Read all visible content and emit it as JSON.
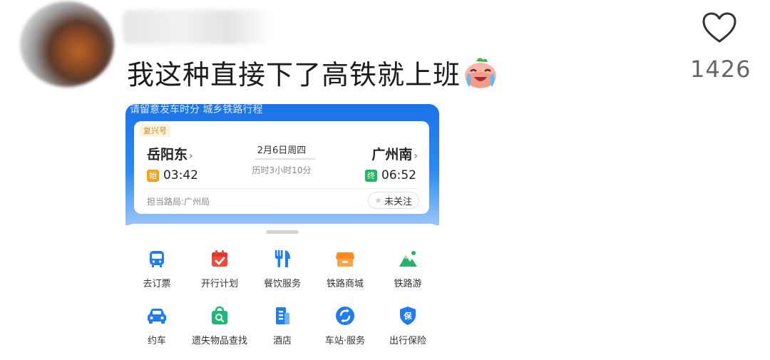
{
  "comment": {
    "text": "我这种直接下了高铁就上班",
    "like_count": "1426"
  },
  "ticket": {
    "cut_text": "请留意发车时分 城乡铁路行程",
    "train_type": "复兴号",
    "from_station": "岳阳东",
    "to_station": "广州南",
    "depart_badge": "始",
    "depart_time": "03:42",
    "arrive_badge": "终",
    "arrive_time": "06:52",
    "date": "2月6日周四",
    "duration": "历时3小时10分",
    "bureau": "担当路局:广州局",
    "follow_label": "未关注",
    "chevron": "›"
  },
  "services": [
    {
      "label": "去订票",
      "icon": "train-ticket-icon",
      "color": "#1f7cf2"
    },
    {
      "label": "开行计划",
      "icon": "calendar-check-icon",
      "color": "#f04b3a"
    },
    {
      "label": "餐饮服务",
      "icon": "fork-knife-icon",
      "color": "#1f7cf2"
    },
    {
      "label": "铁路商城",
      "icon": "shop-icon",
      "color": "#ff8a1f"
    },
    {
      "label": "铁路游",
      "icon": "mountain-icon",
      "color": "#26b36a"
    },
    {
      "label": "约车",
      "icon": "car-icon",
      "color": "#1f7cf2"
    },
    {
      "label": "遗失物品查找",
      "icon": "lost-bag-icon",
      "color": "#1fb87a"
    },
    {
      "label": "酒店",
      "icon": "hotel-building-icon",
      "color": "#1f7cf2"
    },
    {
      "label": "车站·服务",
      "icon": "station-service-icon",
      "color": "#1f7cf2"
    },
    {
      "label": "出行保险",
      "icon": "insurance-shield-icon",
      "color": "#1f7cf2"
    }
  ],
  "colors": {
    "ticket_blue": "#1a73e8",
    "depart_badge": "#f5a31a",
    "arrive_badge": "#27b35f"
  }
}
